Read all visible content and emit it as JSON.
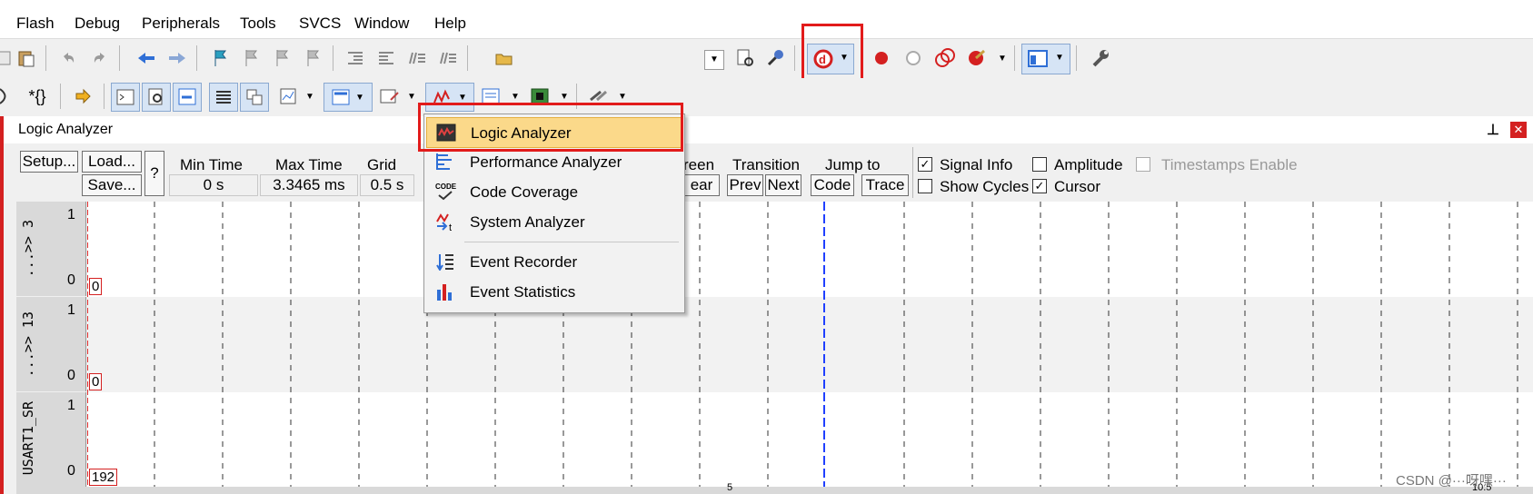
{
  "menubar": {
    "items": [
      "Flash",
      "Debug",
      "Peripherals",
      "Tools",
      "SVCS",
      "Window",
      "Help"
    ]
  },
  "panel": {
    "title": "Logic Analyzer",
    "pin_glyph": "ᵖ",
    "close_glyph": "✕"
  },
  "controls": {
    "setup": "Setup...",
    "load": "Load...",
    "save": "Save...",
    "help": "?",
    "min_time_label": "Min Time",
    "min_time_value": "0 s",
    "max_time_label": "Max Time",
    "max_time_value": "3.3465 ms",
    "grid_label": "Grid",
    "grid_value": "0.5 s",
    "screen_partial": "reen",
    "clear_partial": "ear",
    "transition_label": "Transition",
    "prev": "Prev",
    "next": "Next",
    "jump_label": "Jump to",
    "code": "Code",
    "trace": "Trace",
    "signal_info": "Signal Info",
    "show_cycles": "Show Cycles",
    "amplitude": "Amplitude",
    "cursor": "Cursor",
    "timestamps": "Timestamps Enable",
    "checked_mark": "✓"
  },
  "signals": [
    {
      "name": "...>> 3",
      "high": "1",
      "low": "0",
      "value": "0"
    },
    {
      "name": "...>> 13",
      "high": "1",
      "low": "0",
      "value": "0"
    },
    {
      "name": "USART1_SR",
      "high": "1",
      "low": "0",
      "value": "192"
    }
  ],
  "dropdown": {
    "items": [
      {
        "label": "Logic Analyzer",
        "icon": "logic-analyzer-icon"
      },
      {
        "label": "Performance Analyzer",
        "icon": "performance-analyzer-icon"
      },
      {
        "label": "Code Coverage",
        "icon": "code-coverage-icon",
        "icon_text": "CODE"
      },
      {
        "label": "System Analyzer",
        "icon": "system-analyzer-icon"
      },
      {
        "label": "Event Recorder",
        "icon": "event-recorder-icon"
      },
      {
        "label": "Event Statistics",
        "icon": "event-statistics-icon"
      }
    ]
  },
  "bottom_axis": {
    "mid": "5",
    "end": "10.5"
  },
  "watermark": "CSDN @···呀嘿···",
  "colors": {
    "highlight_red": "#e21b1b",
    "menu_highlight": "#fbd98a",
    "cursor_blue": "#2040ff"
  }
}
